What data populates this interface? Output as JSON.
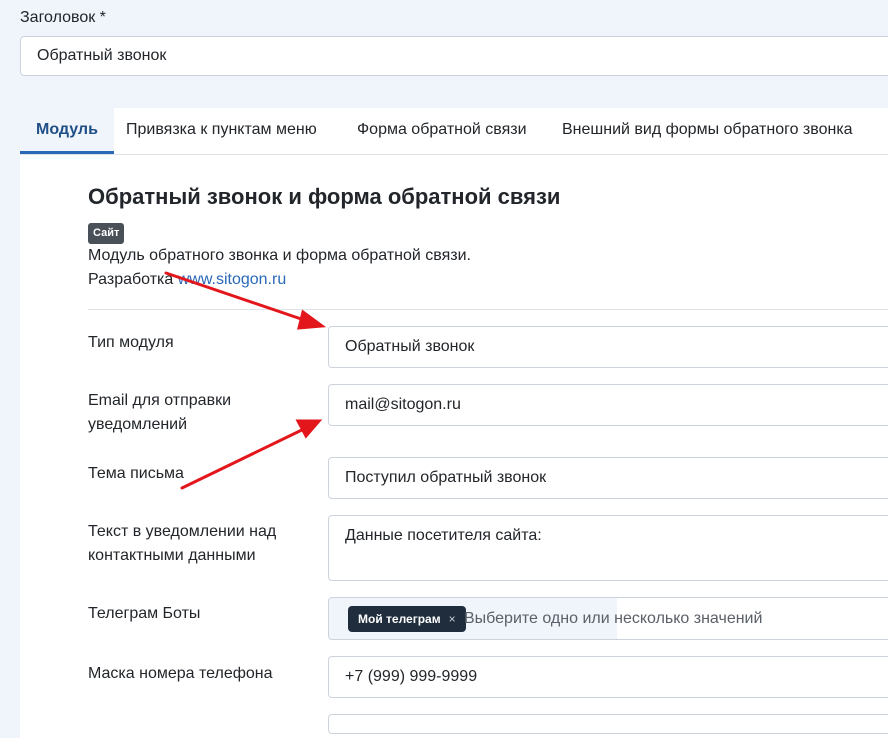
{
  "title_field": {
    "label": "Заголовок *",
    "value": "Обратный звонок"
  },
  "tabs": [
    {
      "label": "Модуль"
    },
    {
      "label": "Привязка к пунктам меню"
    },
    {
      "label": "Форма обратной связи"
    },
    {
      "label": "Внешний вид формы обратного звонка"
    }
  ],
  "module": {
    "title": "Обратный звонок и форма обратной связи",
    "badge": "Сайт",
    "description": "Модуль обратного звонка и форма обратной связи.",
    "developer_prefix": "Разработка ",
    "developer_link": "www.sitogon.ru"
  },
  "fields": {
    "module_type": {
      "label": "Тип модуля",
      "value": "Обратный звонок"
    },
    "email": {
      "label": "Email для отправки уведомлений",
      "value": "mail@sitogon.ru"
    },
    "subject": {
      "label": "Тема письма",
      "value": "Поступил обратный звонок"
    },
    "notify_text": {
      "label": "Текст в уведомлении над контактными данными",
      "value": "Данные посетителя сайта:"
    },
    "telegram": {
      "label": "Телеграм Боты",
      "chip": "Мой телеграм",
      "chip_remove": "×",
      "placeholder": "Выберите одно или несколько значений"
    },
    "phone_mask": {
      "label": "Маска номера телефона",
      "value": "+7 (999) 999-9999"
    }
  },
  "colors": {
    "accent": "#2a69b8",
    "arrow": "#e3161c",
    "chip": "#1f2d3d",
    "badge": "#495057"
  },
  "icons": {
    "chip_remove": "close-icon"
  }
}
